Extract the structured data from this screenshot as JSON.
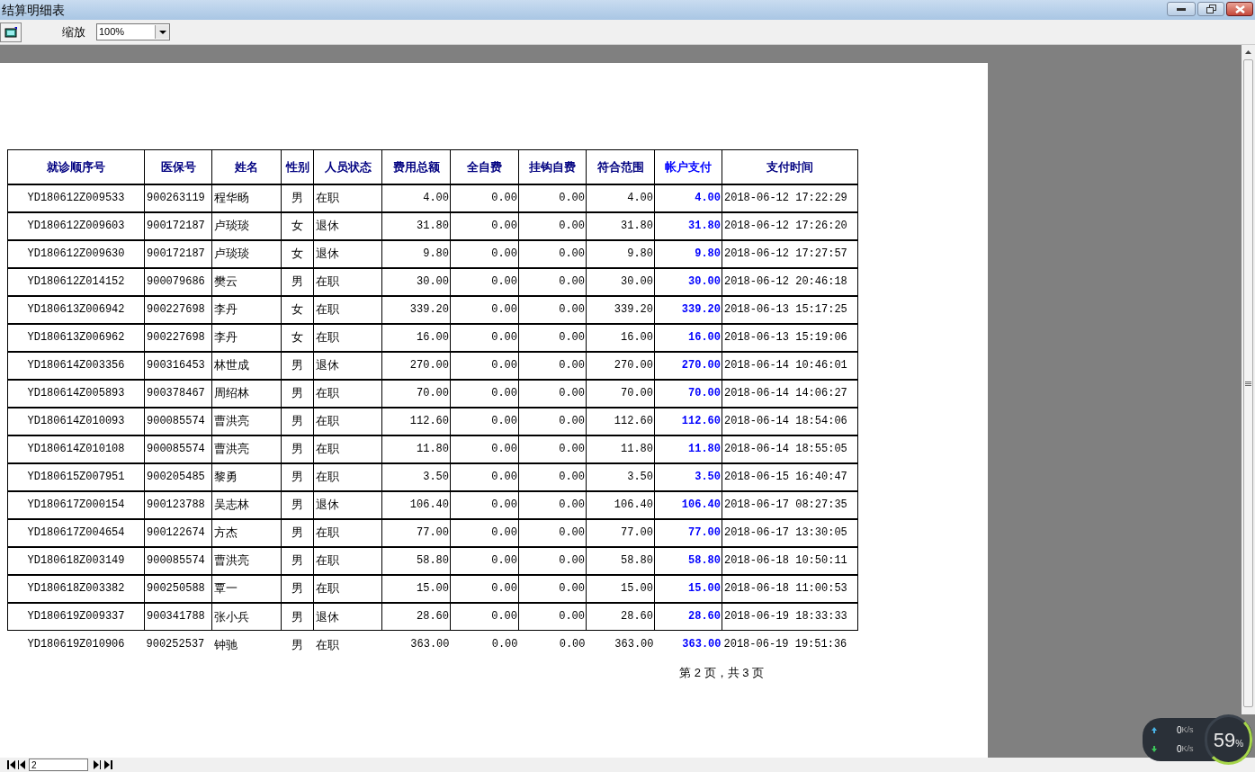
{
  "window": {
    "title": "结算明细表"
  },
  "toolbar": {
    "zoom_label": "缩放",
    "zoom_value": "100%"
  },
  "table": {
    "columns": [
      {
        "label": "就诊顺序号",
        "kind": "code"
      },
      {
        "label": "医保号",
        "kind": "text"
      },
      {
        "label": "姓名",
        "kind": "text"
      },
      {
        "label": "性别",
        "kind": "flag"
      },
      {
        "label": "人员状态",
        "kind": "text"
      },
      {
        "label": "费用总额",
        "kind": "amount"
      },
      {
        "label": "全自费",
        "kind": "amount"
      },
      {
        "label": "挂钩自费",
        "kind": "amount"
      },
      {
        "label": "符合范围",
        "kind": "amount"
      },
      {
        "label": "帐户支付",
        "kind": "payment"
      },
      {
        "label": "支付时间",
        "kind": "text"
      }
    ],
    "rows": [
      {
        "bordered": true,
        "cells": [
          "YD180612Z009533",
          "900263119",
          "程华旸",
          "男",
          "在职",
          "4.00",
          "0.00",
          "0.00",
          "4.00",
          "4.00",
          "2018-06-12 17:22:29"
        ]
      },
      {
        "bordered": true,
        "cells": [
          "YD180612Z009603",
          "900172187",
          "卢琰琰",
          "女",
          "退休",
          "31.80",
          "0.00",
          "0.00",
          "31.80",
          "31.80",
          "2018-06-12 17:26:20"
        ]
      },
      {
        "bordered": true,
        "cells": [
          "YD180612Z009630",
          "900172187",
          "卢琰琰",
          "女",
          "退休",
          "9.80",
          "0.00",
          "0.00",
          "9.80",
          "9.80",
          "2018-06-12 17:27:57"
        ]
      },
      {
        "bordered": true,
        "cells": [
          "YD180612Z014152",
          "900079686",
          "樊云",
          "男",
          "在职",
          "30.00",
          "0.00",
          "0.00",
          "30.00",
          "30.00",
          "2018-06-12 20:46:18"
        ]
      },
      {
        "bordered": true,
        "cells": [
          "YD180613Z006942",
          "900227698",
          "李丹",
          "女",
          "在职",
          "339.20",
          "0.00",
          "0.00",
          "339.20",
          "339.20",
          "2018-06-13 15:17:25"
        ]
      },
      {
        "bordered": true,
        "cells": [
          "YD180613Z006962",
          "900227698",
          "李丹",
          "女",
          "在职",
          "16.00",
          "0.00",
          "0.00",
          "16.00",
          "16.00",
          "2018-06-13 15:19:06"
        ]
      },
      {
        "bordered": true,
        "cells": [
          "YD180614Z003356",
          "900316453",
          "林世成",
          "男",
          "退休",
          "270.00",
          "0.00",
          "0.00",
          "270.00",
          "270.00",
          "2018-06-14 10:46:01"
        ]
      },
      {
        "bordered": true,
        "cells": [
          "YD180614Z005893",
          "900378467",
          "周绍林",
          "男",
          "在职",
          "70.00",
          "0.00",
          "0.00",
          "70.00",
          "70.00",
          "2018-06-14 14:06:27"
        ]
      },
      {
        "bordered": true,
        "cells": [
          "YD180614Z010093",
          "900085574",
          "曹洪亮",
          "男",
          "在职",
          "112.60",
          "0.00",
          "0.00",
          "112.60",
          "112.60",
          "2018-06-14 18:54:06"
        ]
      },
      {
        "bordered": true,
        "cells": [
          "YD180614Z010108",
          "900085574",
          "曹洪亮",
          "男",
          "在职",
          "11.80",
          "0.00",
          "0.00",
          "11.80",
          "11.80",
          "2018-06-14 18:55:05"
        ]
      },
      {
        "bordered": true,
        "cells": [
          "YD180615Z007951",
          "900205485",
          "黎勇",
          "男",
          "在职",
          "3.50",
          "0.00",
          "0.00",
          "3.50",
          "3.50",
          "2018-06-15 16:40:47"
        ]
      },
      {
        "bordered": true,
        "cells": [
          "YD180617Z000154",
          "900123788",
          "吴志林",
          "男",
          "退休",
          "106.40",
          "0.00",
          "0.00",
          "106.40",
          "106.40",
          "2018-06-17 08:27:35"
        ]
      },
      {
        "bordered": true,
        "cells": [
          "YD180617Z004654",
          "900122674",
          "方杰",
          "男",
          "在职",
          "77.00",
          "0.00",
          "0.00",
          "77.00",
          "77.00",
          "2018-06-17 13:30:05"
        ]
      },
      {
        "bordered": true,
        "cells": [
          "YD180618Z003149",
          "900085574",
          "曹洪亮",
          "男",
          "在职",
          "58.80",
          "0.00",
          "0.00",
          "58.80",
          "58.80",
          "2018-06-18 10:50:11"
        ]
      },
      {
        "bordered": true,
        "cells": [
          "YD180618Z003382",
          "900250588",
          "覃一",
          "男",
          "在职",
          "15.00",
          "0.00",
          "0.00",
          "15.00",
          "15.00",
          "2018-06-18 11:00:53"
        ]
      },
      {
        "bordered": true,
        "cells": [
          "YD180619Z009337",
          "900341788",
          "张小兵",
          "男",
          "退休",
          "28.60",
          "0.00",
          "0.00",
          "28.60",
          "28.60",
          "2018-06-19 18:33:33"
        ]
      },
      {
        "bordered": false,
        "cells": [
          "YD180619Z010906",
          "900252537",
          "钟驰",
          "男",
          "在职",
          "363.00",
          "0.00",
          "0.00",
          "363.00",
          "363.00",
          "2018-06-19 19:51:36"
        ]
      }
    ]
  },
  "page_footer": "第 2 页，共 3 页",
  "navigator": {
    "page": "2"
  },
  "net_widget": {
    "upload": "0",
    "upload_unit": "K/s",
    "download": "0",
    "download_unit": "K/s",
    "percent": "59",
    "percent_sign": "%"
  }
}
